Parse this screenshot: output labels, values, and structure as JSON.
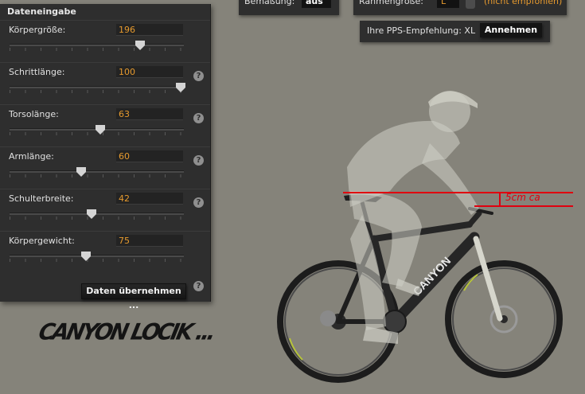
{
  "panel": {
    "title": "Dateneingabe",
    "help_glyph": "?",
    "rows": [
      {
        "label": "Körpergröße:",
        "value": "196",
        "slider_fraction": 0.75,
        "has_help": false
      },
      {
        "label": "Schrittlänge:",
        "value": "100",
        "slider_fraction": 0.98,
        "has_help": true
      },
      {
        "label": "Torsolänge:",
        "value": "63",
        "slider_fraction": 0.52,
        "has_help": true
      },
      {
        "label": "Armlänge:",
        "value": "60",
        "slider_fraction": 0.41,
        "has_help": true
      },
      {
        "label": "Schulterbreite:",
        "value": "42",
        "slider_fraction": 0.47,
        "has_help": true
      },
      {
        "label": "Körpergewicht:",
        "value": "75",
        "slider_fraction": 0.44,
        "has_help": false
      }
    ],
    "apply_button": "Daten übernehmen ..."
  },
  "top": {
    "measurement_label": "Bemaßung:",
    "measurement_value": "aus",
    "frame_label": "Rahmengröße:",
    "frame_value": "L",
    "frame_note": "(nicht empfohlen)",
    "pps_label": "Ihre PPS-Empfehlung: XL",
    "accept_button": "Annehmen"
  },
  "bike": {
    "downtube_text": "CANYON"
  },
  "annotation": "5cm ca",
  "caption": "CANYON LOCIK ...",
  "colors": {
    "panel": "#2e2e2e",
    "background": "#85837a",
    "accent_orange": "#e69a2e",
    "annotation_red": "#e0000f"
  }
}
